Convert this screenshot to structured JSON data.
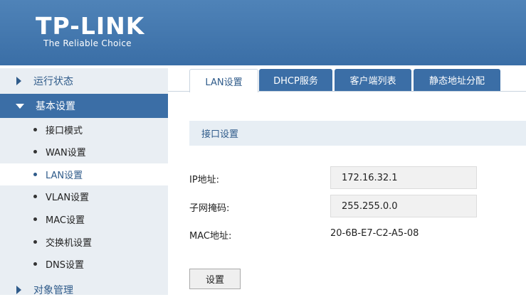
{
  "brand": {
    "name": "TP-LINK",
    "tagline": "The Reliable Choice"
  },
  "sidebar": {
    "menus": [
      {
        "label": "运行状态"
      },
      {
        "label": "基本设置"
      },
      {
        "label": "对象管理"
      }
    ],
    "sub_items": [
      {
        "label": "接口模式"
      },
      {
        "label": "WAN设置"
      },
      {
        "label": "LAN设置"
      },
      {
        "label": "VLAN设置"
      },
      {
        "label": "MAC设置"
      },
      {
        "label": "交换机设置"
      },
      {
        "label": "DNS设置"
      }
    ]
  },
  "tabs": [
    {
      "label": "LAN设置"
    },
    {
      "label": "DHCP服务"
    },
    {
      "label": "客户端列表"
    },
    {
      "label": "静态地址分配"
    }
  ],
  "section": {
    "title": "接口设置"
  },
  "form": {
    "ip_label": "IP地址:",
    "ip_value": "172.16.32.1",
    "mask_label": "子网掩码:",
    "mask_value": "255.255.0.0",
    "mac_label": "MAC地址:",
    "mac_value": "20-6B-E7-C2-A5-08",
    "submit_label": "设置"
  },
  "colors": {
    "header": "#3f74ab",
    "accent": "#2f5b8a",
    "sidebar_bg": "#e9eef3"
  }
}
